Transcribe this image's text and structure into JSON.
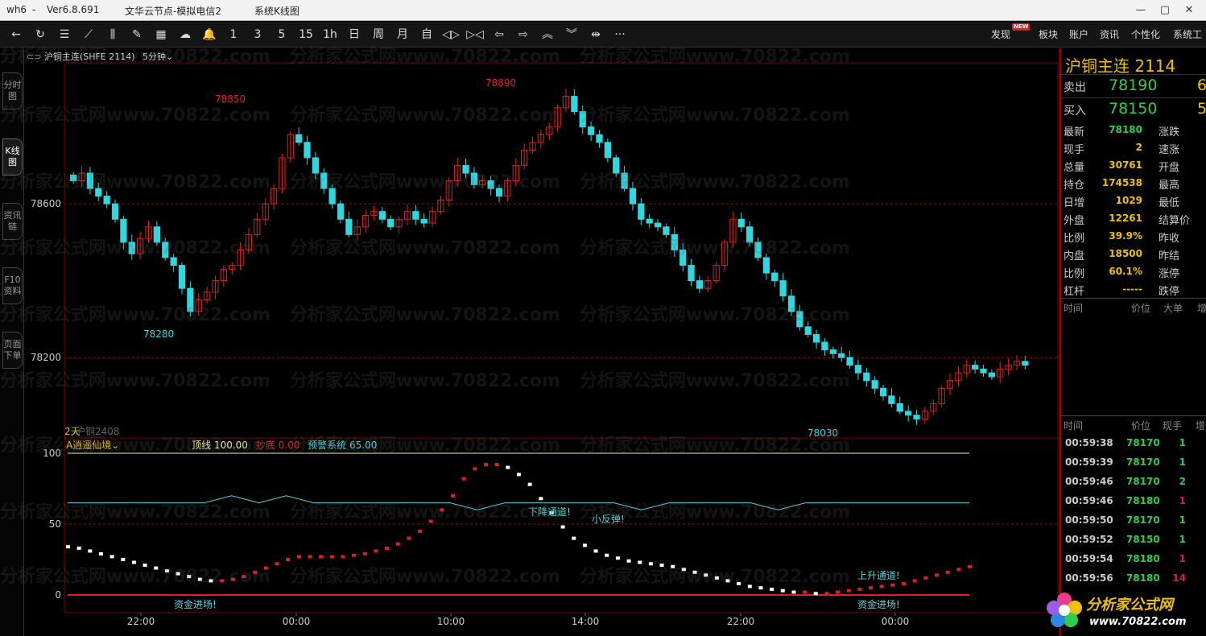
{
  "titlebar": {
    "app": "wh6",
    "sep": "-",
    "version": "Ver6.8.691",
    "node": "文华云节点-模拟电信2",
    "mode": "系统K线图"
  },
  "window_buttons": [
    "—",
    "▢",
    "✕"
  ],
  "toolbar": {
    "icons": [
      {
        "name": "back-icon",
        "glyph": "←"
      },
      {
        "name": "refresh-icon",
        "glyph": "↻"
      },
      {
        "name": "list-icon",
        "glyph": "☰"
      },
      {
        "name": "line-chart-icon",
        "glyph": "⟋"
      },
      {
        "name": "kline-icon",
        "glyph": "⫼"
      },
      {
        "name": "draw-icon",
        "glyph": "✎"
      },
      {
        "name": "grid-icon",
        "glyph": "▦"
      },
      {
        "name": "cloud-icon",
        "glyph": "☁"
      },
      {
        "name": "bell-icon",
        "glyph": "🔔"
      }
    ],
    "periods": [
      "1",
      "3",
      "5",
      "15",
      "1h",
      "日",
      "周",
      "月",
      "自"
    ],
    "nav_icons": [
      {
        "name": "zoom-in-icon",
        "glyph": "◁▷"
      },
      {
        "name": "zoom-out-icon",
        "glyph": "▷◁"
      },
      {
        "name": "arrow-left-icon",
        "glyph": "⇦"
      },
      {
        "name": "arrow-right-icon",
        "glyph": "⇨"
      },
      {
        "name": "scroll-up-icon",
        "glyph": "︽"
      },
      {
        "name": "scroll-down-icon",
        "glyph": "︾"
      },
      {
        "name": "crosshair-icon",
        "glyph": "⇹"
      },
      {
        "name": "more-icon",
        "glyph": "···"
      }
    ],
    "right_menu": [
      "发现",
      "板块",
      "账户",
      "资讯",
      "个性化",
      "系统工"
    ],
    "new_badge": "NEW"
  },
  "sidetabs": [
    "分时图",
    "K线图",
    "资讯链",
    "F10资料",
    "页面下单"
  ],
  "chart": {
    "symbol_icon": "⊂⊃",
    "symbol": "沪铜主连(SHFE 2114)",
    "period": "5分钟",
    "price_axis": [
      "78600",
      "78200"
    ],
    "annotations": [
      "78850",
      "78890",
      "78280",
      "78030"
    ],
    "sub_label": "2天",
    "contract_label": "沪铜2408",
    "indicator": {
      "name": "A逍遥仙境",
      "top_label": "顶线",
      "top_value": "100.00",
      "bottom_label": "抄底",
      "bottom_value": "0.00",
      "warn_label": "预警系统",
      "warn_value": "65.00"
    },
    "ind_axis": [
      "100",
      "50",
      "0"
    ],
    "signals": [
      "下降通道!",
      "小反弹!",
      "上升通道!",
      "资金进场!",
      "资金进场!"
    ],
    "time_axis": [
      "22:00",
      "00:00",
      "10:00",
      "14:00",
      "22:00",
      "00:00"
    ]
  },
  "chart_data": {
    "type": "candlestick",
    "price_ylim": [
      78020,
      78900
    ],
    "indicator_ylim": [
      0,
      100
    ],
    "closes": [
      78660,
      78680,
      78640,
      78620,
      78600,
      78560,
      78500,
      78470,
      78510,
      78540,
      78500,
      78460,
      78440,
      78380,
      78320,
      78350,
      78370,
      78400,
      78430,
      78440,
      78480,
      78520,
      78560,
      78600,
      78640,
      78720,
      78780,
      78760,
      78720,
      78680,
      78640,
      78600,
      78560,
      78520,
      78540,
      78570,
      78580,
      78560,
      78540,
      78560,
      78580,
      78560,
      78550,
      78580,
      78610,
      78660,
      78700,
      78680,
      78650,
      78660,
      78640,
      78620,
      78660,
      78700,
      78740,
      78760,
      78780,
      78800,
      78850,
      78880,
      78840,
      78800,
      78780,
      78760,
      78720,
      78680,
      78640,
      78600,
      78560,
      78550,
      78540,
      78520,
      78480,
      78440,
      78400,
      78380,
      78400,
      78440,
      78500,
      78560,
      78540,
      78500,
      78460,
      78420,
      78400,
      78360,
      78320,
      78280,
      78260,
      78240,
      78220,
      78210,
      78200,
      78180,
      78160,
      78140,
      78120,
      78100,
      78080,
      78060,
      78050,
      78040,
      78060,
      78080,
      78120,
      78140,
      78160,
      78180,
      78170,
      78160,
      78150,
      78170,
      78180,
      78190,
      78180
    ],
    "osc_line": [
      34,
      33,
      31,
      29,
      27,
      25,
      23,
      21,
      19,
      17,
      15,
      13,
      11,
      10,
      10,
      11,
      13,
      16,
      19,
      22,
      25,
      27,
      27,
      27,
      27,
      27,
      28,
      29,
      31,
      33,
      36,
      40,
      45,
      52,
      60,
      70,
      82,
      89,
      92,
      92,
      90,
      85,
      78,
      68,
      58,
      48,
      40,
      35,
      31,
      28,
      26,
      24,
      23,
      22,
      21,
      20,
      18,
      16,
      14,
      12,
      10,
      8,
      6,
      5,
      4,
      3,
      2,
      2,
      1,
      1,
      2,
      3,
      4,
      5,
      6,
      7,
      8,
      10,
      12,
      14,
      16,
      18,
      20
    ],
    "warn_line": [
      65,
      65,
      65,
      65,
      65,
      65,
      70,
      65,
      70,
      65,
      65,
      65,
      65,
      65,
      65,
      60,
      65,
      65,
      65,
      65,
      65,
      60,
      65,
      65,
      65,
      65,
      60,
      65,
      65,
      65,
      65,
      65,
      65,
      65
    ]
  },
  "quote": {
    "title": "沪铜主连",
    "code": "2114",
    "sell_label": "卖出",
    "sell_price": "78190",
    "sell_vol": "6",
    "buy_label": "买入",
    "buy_price": "78150",
    "buy_vol": "5",
    "rows": [
      {
        "label": "最新",
        "value": "78180",
        "label2": "涨跌",
        "color": "#2ad04a"
      },
      {
        "label": "现手",
        "value": "2",
        "label2": "速涨"
      },
      {
        "label": "总量",
        "value": "30761",
        "label2": "开盘"
      },
      {
        "label": "持仓",
        "value": "174538",
        "label2": "最高"
      },
      {
        "label": "日增",
        "value": "1029",
        "label2": "最低"
      },
      {
        "label": "外盘",
        "value": "12261",
        "label2": "结算价"
      },
      {
        "label": "比例",
        "value": "39.9%",
        "label2": "昨收"
      },
      {
        "label": "内盘",
        "value": "18500",
        "label2": "昨结"
      },
      {
        "label": "比例",
        "value": "60.1%",
        "label2": "涨停"
      },
      {
        "label": "杠杆",
        "value": "-----",
        "label2": "跌停"
      }
    ],
    "head1": [
      "时间",
      "价位",
      "大单",
      "增"
    ],
    "head2": [
      "时间",
      "价位",
      "现手",
      "增"
    ],
    "ticks": [
      {
        "time": "00:59:38",
        "price": "78170",
        "vol": "1",
        "pc": "#2ad04a",
        "vc": "#2ad04a"
      },
      {
        "time": "00:59:39",
        "price": "78170",
        "vol": "1",
        "pc": "#2ad04a",
        "vc": "#2ad04a"
      },
      {
        "time": "00:59:46",
        "price": "78170",
        "vol": "2",
        "pc": "#2ad04a",
        "vc": "#2ad04a"
      },
      {
        "time": "00:59:46",
        "price": "78180",
        "vol": "1",
        "pc": "#2ad04a",
        "vc": "#e02020"
      },
      {
        "time": "00:59:50",
        "price": "78170",
        "vol": "1",
        "pc": "#2ad04a",
        "vc": "#2ad04a"
      },
      {
        "time": "00:59:52",
        "price": "78150",
        "vol": "1",
        "pc": "#2ad04a",
        "vc": "#2ad04a"
      },
      {
        "time": "00:59:54",
        "price": "78180",
        "vol": "1",
        "pc": "#2ad04a",
        "vc": "#e02020"
      },
      {
        "time": "00:59:56",
        "price": "78180",
        "vol": "14",
        "pc": "#2ad04a",
        "vc": "#e02020"
      }
    ]
  },
  "watermark": "分析家公式网www.70822.com",
  "logo": {
    "name": "分析家公式网",
    "url": "www.70822.com"
  },
  "colors": {
    "up": "#e02020",
    "down": "#2fd8e0",
    "accent": "#f0c000",
    "green": "#2ad04a"
  }
}
